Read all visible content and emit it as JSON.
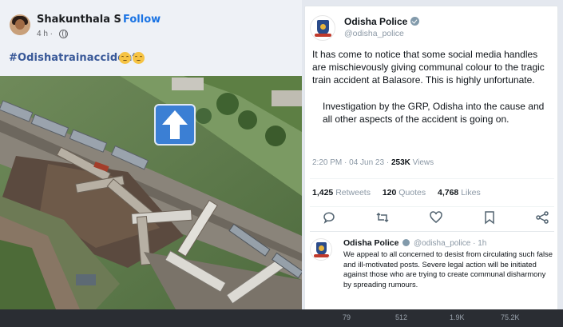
{
  "facebook_post": {
    "author": "Shakunthala S",
    "separator": "·",
    "follow_label": "Follow",
    "time": "4 h ·",
    "hashtag": "#Odishatrainaccident."
  },
  "tweet": {
    "display_name": "Odisha Police",
    "handle": "@odisha_police",
    "paragraph_1": "It has come to notice that some social media handles are mischievously giving communal colour to the tragic train accident at Balasore. This is highly unfortunate.",
    "paragraph_2": "Investigation by the GRP, Odisha into the cause and all other aspects of the accident is going on.",
    "timestamp": "2:20 PM · 04 Jun 23 ·",
    "views_count": "253K",
    "views_label": "Views",
    "retweets_count": "1,425",
    "retweets_label": "Retweets",
    "quotes_count": "120",
    "quotes_label": "Quotes",
    "likes_count": "4,768",
    "likes_label": "Likes",
    "icons": [
      "reply-icon",
      "retweet-icon",
      "like-icon",
      "bookmark-icon",
      "share-icon"
    ]
  },
  "reply": {
    "display_name": "Odisha Police",
    "handle_time": "@odisha_police · 1h",
    "text": "We appeal to all concerned to desist from circulating such false and ill-motivated posts. Severe legal action will be initiated against those who are trying to create communal disharmony by spreading rumours.",
    "action_counts": [
      "79",
      "512",
      "1.9K",
      "75.2K"
    ]
  },
  "colors": {
    "facebook_link": "#1b74e4",
    "hashtag": "#385898",
    "twitter_text": "#0f1419",
    "twitter_muted": "#8b98a5",
    "arrow_overlay": "#3b7fd4"
  }
}
